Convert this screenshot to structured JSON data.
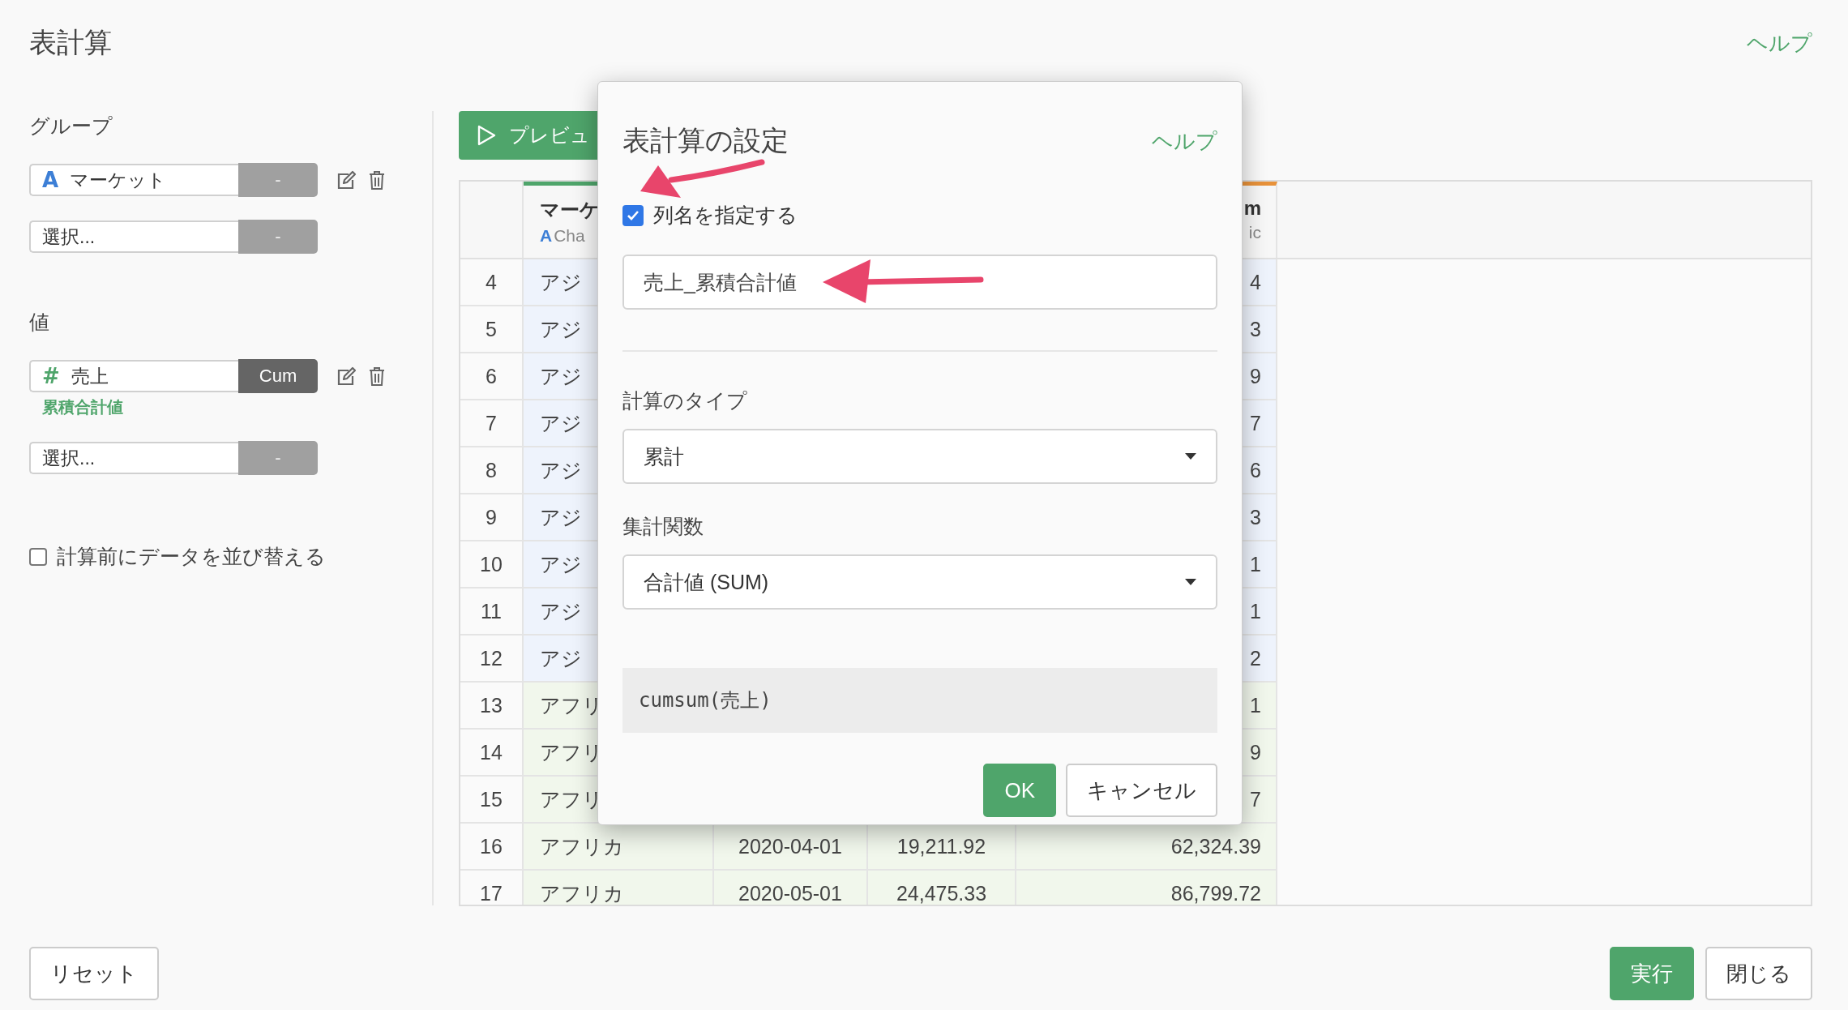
{
  "page": {
    "title": "表計算",
    "help": "ヘルプ"
  },
  "sidebar": {
    "group_label": "グループ",
    "groups": [
      {
        "kind": "field",
        "glyph": "A",
        "color": "#3d7fd6",
        "label": "マーケット",
        "button": "-",
        "active": false
      },
      {
        "kind": "select",
        "placeholder": "選択...",
        "button": "-",
        "active": false
      }
    ],
    "value_label": "値",
    "values": [
      {
        "kind": "field",
        "glyph": "#",
        "color": "#4fa56b",
        "label": "売上",
        "button": "Cum",
        "active": true,
        "note": "累積合計値"
      },
      {
        "kind": "select",
        "placeholder": "選択...",
        "button": "-",
        "active": false
      }
    ],
    "sort_option": {
      "label": "計算前にデータを並び替える",
      "checked": false
    }
  },
  "preview": {
    "label": "プレビュ"
  },
  "table": {
    "columns": [
      {
        "kind": "header",
        "name": "マーケ",
        "glyph": "A",
        "type": "Cha",
        "color": "#4fa56b"
      },
      {
        "kind": "covered"
      },
      {
        "kind": "covered"
      },
      {
        "kind": "header",
        "name": "m",
        "type": "ic",
        "color": "#e8923a"
      }
    ],
    "rows": [
      {
        "number": "4",
        "color": "#eef3fc",
        "market": "アジ",
        "cum": "4"
      },
      {
        "number": "5",
        "color": "#eef3fc",
        "market": "アジ",
        "cum": "3"
      },
      {
        "number": "6",
        "color": "#eef3fc",
        "market": "アジ",
        "cum": "9"
      },
      {
        "number": "7",
        "color": "#eef3fc",
        "market": "アジ",
        "cum": "7"
      },
      {
        "number": "8",
        "color": "#eef3fc",
        "market": "アジ",
        "cum": "6"
      },
      {
        "number": "9",
        "color": "#eef3fc",
        "market": "アジ",
        "cum": "3"
      },
      {
        "number": "10",
        "color": "#eef3fc",
        "market": "アジ",
        "cum": "1"
      },
      {
        "number": "11",
        "color": "#eef3fc",
        "market": "アジ",
        "cum": "1"
      },
      {
        "number": "12",
        "color": "#eef3fc",
        "market": "アジ",
        "cum": "2"
      },
      {
        "number": "13",
        "color": "#f1f7ec",
        "market": "アフリ",
        "cum": "1"
      },
      {
        "number": "14",
        "color": "#f1f7ec",
        "market": "アフリ",
        "cum": "9"
      },
      {
        "number": "15",
        "color": "#f1f7ec",
        "market": "アフリ",
        "cum": "7"
      },
      {
        "number": "16",
        "color": "#f1f7ec",
        "market": "アフリカ",
        "date": "2020-04-01",
        "value": "19,211.92",
        "cum": "62,324.39"
      },
      {
        "number": "17",
        "color": "#f1f7ec",
        "market": "アフリカ",
        "date": "2020-05-01",
        "value": "24,475.33",
        "cum": "86,799.72"
      }
    ]
  },
  "dialog": {
    "title": "表計算の設定",
    "help": "ヘルプ",
    "name_option": {
      "label": "列名を指定する",
      "checked": true
    },
    "name_field": {
      "value": "売上_累積合計値"
    },
    "calc_type": {
      "label": "計算のタイプ",
      "value": "累計"
    },
    "aggregate": {
      "label": "集計関数",
      "value": "合計値 (SUM)"
    },
    "expression": "cumsum(売上)",
    "buttons": [
      {
        "label": "OK",
        "kind": "primary"
      },
      {
        "label": "キャンセル",
        "kind": "default"
      }
    ]
  },
  "footer": {
    "reset": "リセット",
    "buttons": [
      {
        "label": "実行",
        "kind": "primary"
      },
      {
        "label": "閉じる",
        "kind": "default"
      }
    ]
  }
}
